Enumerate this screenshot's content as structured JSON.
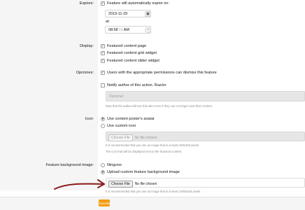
{
  "expires": {
    "label": "Expires:",
    "checkbox_label": "Feature will automatically expire on:",
    "date_value": "2019-11-29",
    "at_label": "at:",
    "time_value": "08:58",
    "time_seconds": ":11",
    "time_ampm": "AM",
    "calendar_icon": "calendar-icon",
    "clock_icon": "clock-icon"
  },
  "display": {
    "label": "Display:",
    "options": [
      {
        "label": "Featured content page",
        "checked": true
      },
      {
        "label": "Featured content grid widget",
        "checked": true
      },
      {
        "label": "Featured content slider widget",
        "checked": true
      }
    ]
  },
  "opciones": {
    "label": "Opciones:",
    "dismiss_label": "Users with the appropriate permissions can dismiss this feature",
    "notify_label": "Notify author of this action. Razón:",
    "reason_placeholder": "Opcional",
    "notify_hint": "Note that the author will see this alert even if they can no longer view their content."
  },
  "icon": {
    "label": "Icon:",
    "options": [
      {
        "label": "Use content poster's avatar",
        "selected": true
      },
      {
        "label": "Use custom icon",
        "selected": false
      }
    ],
    "choose_file_label": "Choose File",
    "no_file_label": "No file chosen",
    "hint1": "It is recommended that you use an image that is at least 400x400 pixels.",
    "hint2": "The icon that will be displayed next to the featured content."
  },
  "background": {
    "label": "Feature background image:",
    "options": [
      {
        "label": "Ninguno",
        "selected": false
      },
      {
        "label": "Upload custom feature background image",
        "selected": true
      }
    ],
    "choose_file_label": "Choose File",
    "no_file_label": "No file chosen",
    "hint": "It is recommended that you use an image that is at least 1000x543 pixels."
  },
  "save": {
    "label": "Guardar",
    "icon": "save-icon",
    "color": "#f39c12"
  },
  "annotation": {
    "arrow_color": "#8b1a1a"
  }
}
